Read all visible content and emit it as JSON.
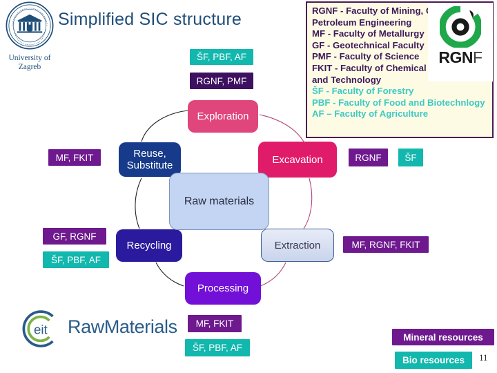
{
  "page": {
    "title": "Simplified SIC structure",
    "slide_number": "11"
  },
  "university_logo": {
    "name": "university-of-zagreb-seal",
    "caption_line1": "University of",
    "caption_line2": "Zagreb"
  },
  "rgnf_logo": {
    "wordmark_bold": "RGN",
    "wordmark_thin": "F",
    "mark_color_green": "#1FA84A",
    "mark_color_black": "#1A1A1A"
  },
  "legend": {
    "border_color": "#4B1A52",
    "background_color": "#FDFBE4",
    "mineral_text_color": "#3D1A5B",
    "bio_text_color": "#3FC9C2",
    "lines": [
      {
        "abbr": "RGNF",
        "text": " - Faculty of Mining, Geology and",
        "type": "mineral"
      },
      {
        "abbr": "",
        "text": "Petroleum Engineering",
        "type": "mineral"
      },
      {
        "abbr": "MF",
        "text": " - Faculty of Metallurgy",
        "type": "mineral"
      },
      {
        "abbr": "GF",
        "text": " - Geotechnical Faculty",
        "type": "mineral"
      },
      {
        "abbr": "PMF",
        "text": " - Faculty of Science",
        "type": "mineral"
      },
      {
        "abbr": "FKIT",
        "text": " - Faculty of Chemical Engineering",
        "type": "mineral"
      },
      {
        "abbr": "",
        "text": "and Technology",
        "type": "mineral"
      },
      {
        "abbr": "ŠF",
        "text": " - Faculty of Forestry",
        "type": "bio"
      },
      {
        "abbr": "PBF",
        "text": " - Faculty of Food and Biotechnlogy",
        "type": "bio"
      },
      {
        "abbr": "AF",
        "text": " – Faculty of Agriculture",
        "type": "bio"
      }
    ]
  },
  "cycle": {
    "center": {
      "label": "Raw materials",
      "color": "#C3D5F2"
    },
    "nodes": {
      "exploration": {
        "label": "Exploration",
        "color": "#E0457B"
      },
      "excavation": {
        "label": "Excavation",
        "color": "#E01B6A"
      },
      "extraction": {
        "label": "Extraction",
        "color": "#C9D4EC"
      },
      "processing": {
        "label": "Processing",
        "color": "#7310D8"
      },
      "recycling": {
        "label": "Recycling",
        "color": "#2A1B9E"
      },
      "reuse": {
        "label": "Reuse,\nSubstitute",
        "line1": "Reuse,",
        "line2": "Substitute",
        "color": "#173B8A"
      }
    }
  },
  "chips": {
    "top_bio": "ŠF, PBF, AF",
    "top_dark": "RGNF, PMF",
    "left_mf_fkit": "MF, FKIT",
    "gf_rgnf": "GF, RGNF",
    "sf_pbf_af_left": "ŠF, PBF, AF",
    "rgnf_right": "RGNF",
    "sf_right": "ŠF",
    "mf_rgnf_fkit": "MF, RGNF, FKIT",
    "bottom_mineral": "MF, FKIT",
    "bottom_bio": "ŠF, PBF, AF"
  },
  "key_legend": {
    "mineral": "Mineral resources",
    "bio": "Bio resources",
    "mineral_color": "#6E1A8E",
    "bio_color": "#12B7AD"
  },
  "eit_logo": {
    "mark_label": "eit",
    "wordmark": "RawMaterials",
    "blue": "#2A5C8A",
    "green": "#7CB342"
  }
}
